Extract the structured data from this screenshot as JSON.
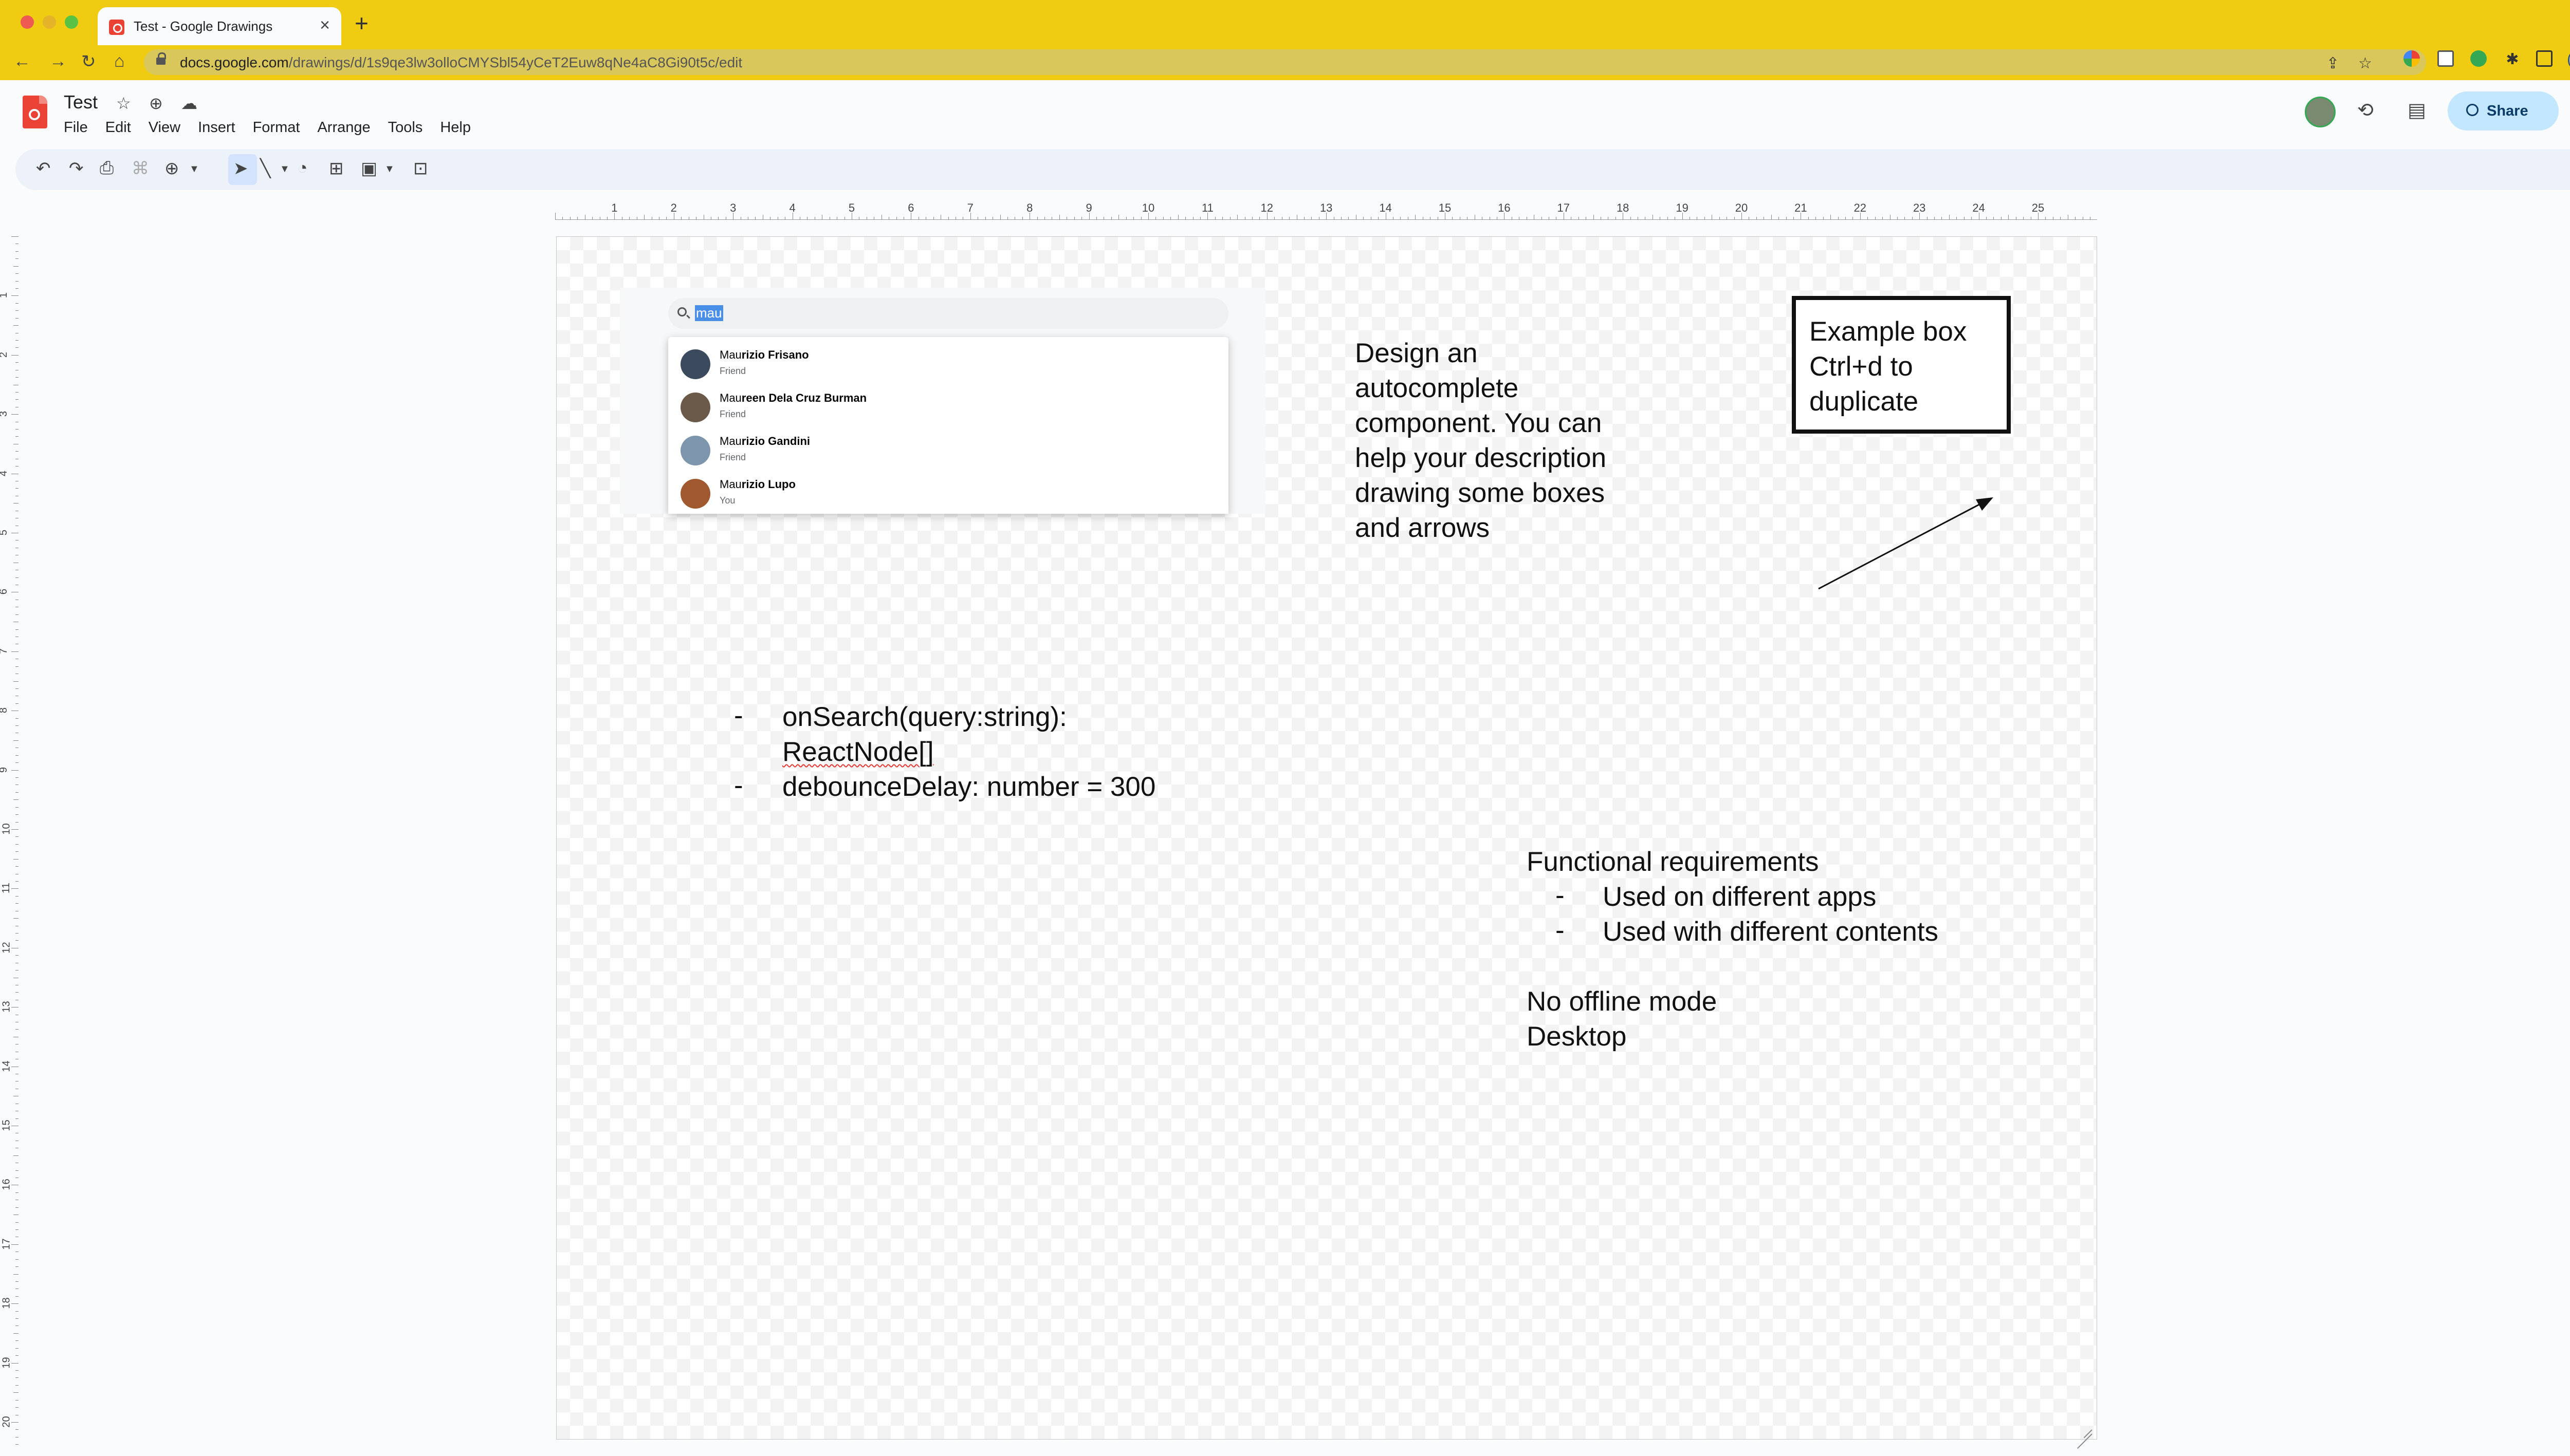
{
  "browser": {
    "tab_title": "Test - Google Drawings",
    "url_host": "docs.google.com",
    "url_path": "/drawings/d/1s9qe3lw3olloCMYSbl54yCeT2Euw8qNe4aC8Gi90t5c/edit"
  },
  "doc": {
    "title": "Test",
    "menu": [
      "File",
      "Edit",
      "View",
      "Insert",
      "Format",
      "Arrange",
      "Tools",
      "Help"
    ],
    "share_label": "Share"
  },
  "ruler": {
    "h_labels": [
      "1",
      "2",
      "3",
      "4",
      "5",
      "6",
      "7",
      "8",
      "9",
      "10",
      "11",
      "12",
      "13",
      "14",
      "15",
      "16",
      "17",
      "18",
      "19",
      "20",
      "21",
      "22",
      "23",
      "24",
      "25"
    ],
    "v_labels": [
      "1",
      "2",
      "3",
      "4",
      "5",
      "6",
      "7",
      "8",
      "9",
      "10",
      "11",
      "12",
      "13",
      "14",
      "15",
      "16",
      "17",
      "18",
      "19",
      "20"
    ]
  },
  "autocomplete_mock": {
    "query": "mau",
    "results": [
      {
        "match": "Mau",
        "rest": "rizio Frisano",
        "sub": "Friend",
        "avatar_color": "#3b4a5c"
      },
      {
        "match": "Mau",
        "rest": "reen Dela Cruz Burman",
        "sub": "Friend",
        "avatar_color": "#6b5a4a"
      },
      {
        "match": "Mau",
        "rest": "rizio Gandini",
        "sub": "Friend",
        "avatar_color": "#7d95ad"
      },
      {
        "match": "Mau",
        "rest": "rizio Lupo",
        "sub": "You",
        "avatar_color": "#a0582e"
      }
    ]
  },
  "canvas": {
    "description": "Design an\nautocomplete\ncomponent. You can\nhelp your description\ndrawing some boxes\nand arrows",
    "example_box": "Example box\nCtrl+d to\nduplicate",
    "api": {
      "bullet": "-",
      "line1": "onSearch(query:string):",
      "line2": "ReactNode[]",
      "line3": "debounceDelay: number = 300"
    },
    "requirements": {
      "heading": "Functional requirements",
      "bullet": "-",
      "items": [
        "Used on different apps",
        "Used with different contents"
      ],
      "notes": [
        "No offline mode",
        "Desktop"
      ]
    }
  }
}
